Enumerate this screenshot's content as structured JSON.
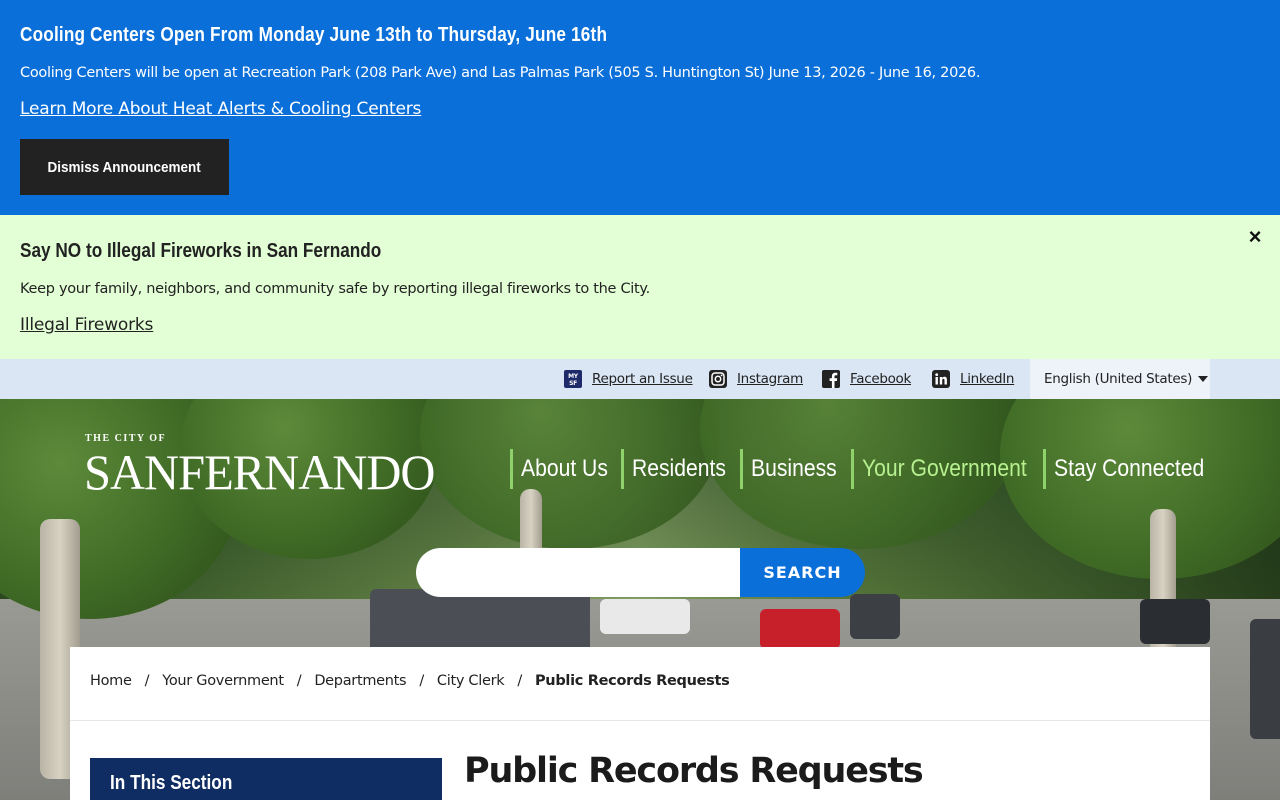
{
  "announcement_1": {
    "title": "Cooling Centers Open From Monday June 13th to Thursday, June 16th",
    "body": "Cooling Centers will be open at Recreation Park (208 Park Ave) and Las Palmas Park (505 S. Huntington St) June 13, 2026 - June 16, 2026.",
    "link": "Learn More About Heat Alerts & Cooling Centers",
    "dismiss_label": "Dismiss Announcement",
    "background": "#0a6fd9"
  },
  "announcement_2": {
    "title": "Say NO to Illegal Fireworks in San Fernando",
    "body": "Keep your family, neighbors, and community safe by reporting illegal fireworks to the City.",
    "link": "Illegal Fireworks",
    "close_icon": "×",
    "background": "#e3ffd5"
  },
  "utility_bar": {
    "items": [
      {
        "label": "Report an Issue",
        "icon": "mysf-icon"
      },
      {
        "label": "Instagram",
        "icon": "instagram-icon"
      },
      {
        "label": "Facebook",
        "icon": "facebook-icon"
      },
      {
        "label": "LinkedIn",
        "icon": "linkedin-icon"
      }
    ],
    "language": "English (United States)"
  },
  "header": {
    "logo_small": "THE CITY OF",
    "logo_big": "SANFERNANDO",
    "nav": [
      "About Us",
      "Residents",
      "Business",
      "Your Government",
      "Stay Connected"
    ],
    "active_nav": "Your Government",
    "search_placeholder": "",
    "search_button": "SEARCH",
    "accent": "#8fd16a"
  },
  "breadcrumb": {
    "items": [
      "Home",
      "Your Government",
      "Departments",
      "City Clerk"
    ],
    "current": "Public Records Requests"
  },
  "sidebar": {
    "title": "In This Section"
  },
  "page": {
    "title": "Public Records Requests"
  }
}
